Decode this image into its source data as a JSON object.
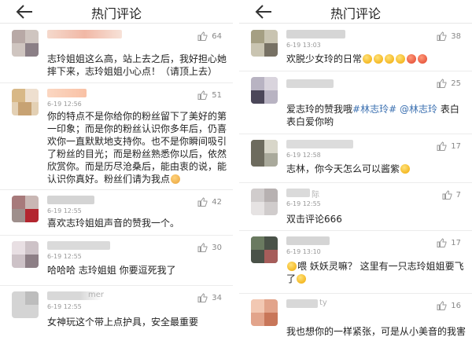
{
  "left": {
    "title": "热门评论",
    "comments": [
      {
        "time": "",
        "likes": "64",
        "text": "志玲姐姐这么高，站上去之后，我好担心她摔下来，志玲姐姐小心点！（请顶上去）"
      },
      {
        "time": "6-19 12:56",
        "likes": "51",
        "text": "你的特点不是你给你的粉丝留下了美好的第一印象；而是你的粉丝认识你多年后，仍喜欢你一直默默地支持你。也不是你瞬间吸引了粉丝的目光；而是粉丝熟悉你以后，依然欣赏你。而是历尽沧桑后，能由衷的说，能认识你真好。粉丝们请为我点"
      },
      {
        "time": "6-19 12:55",
        "likes": "42",
        "text": "喜欢志玲姐姐声音的赞我一个。"
      },
      {
        "time": "6-19 12:55",
        "likes": "30",
        "text": "哈哈哈 志玲姐姐 你要逗死我了"
      },
      {
        "time": "6-19 12:55",
        "name_fragment": "mer",
        "likes": "34",
        "text": "女神玩这个带上点护具，安全最重要"
      }
    ]
  },
  "right": {
    "title": "热门评论",
    "comments": [
      {
        "time": "6-19 13:03",
        "likes": "38",
        "text": "欢脱少女玲的日常"
      },
      {
        "time": "",
        "likes": "25",
        "text_prefix": "爱志玲的赞我哦",
        "tag1": "#林志玲#",
        "tag2": "@林志玲",
        "text_suffix": "表白表白爱你哟"
      },
      {
        "time": "6-19 12:58",
        "likes": "17",
        "text": "志林，你今天怎么可以酱紫"
      },
      {
        "time": "6-19 12:55",
        "name_fragment": "际",
        "likes": "7",
        "text": "双击评论666"
      },
      {
        "time": "6-19 13:10",
        "likes": "17",
        "text": "喂  妖妖灵嘛？  这里有一只志玲姐姐要飞了"
      },
      {
        "time": "",
        "name_fragment": "ty",
        "likes": "16",
        "text": "我也想你的一样紧张，可是从小美音的我害"
      }
    ]
  },
  "icons": {
    "back": "back-arrow-icon",
    "like": "thumbs-up-icon",
    "emoji": "emoji-icon"
  }
}
